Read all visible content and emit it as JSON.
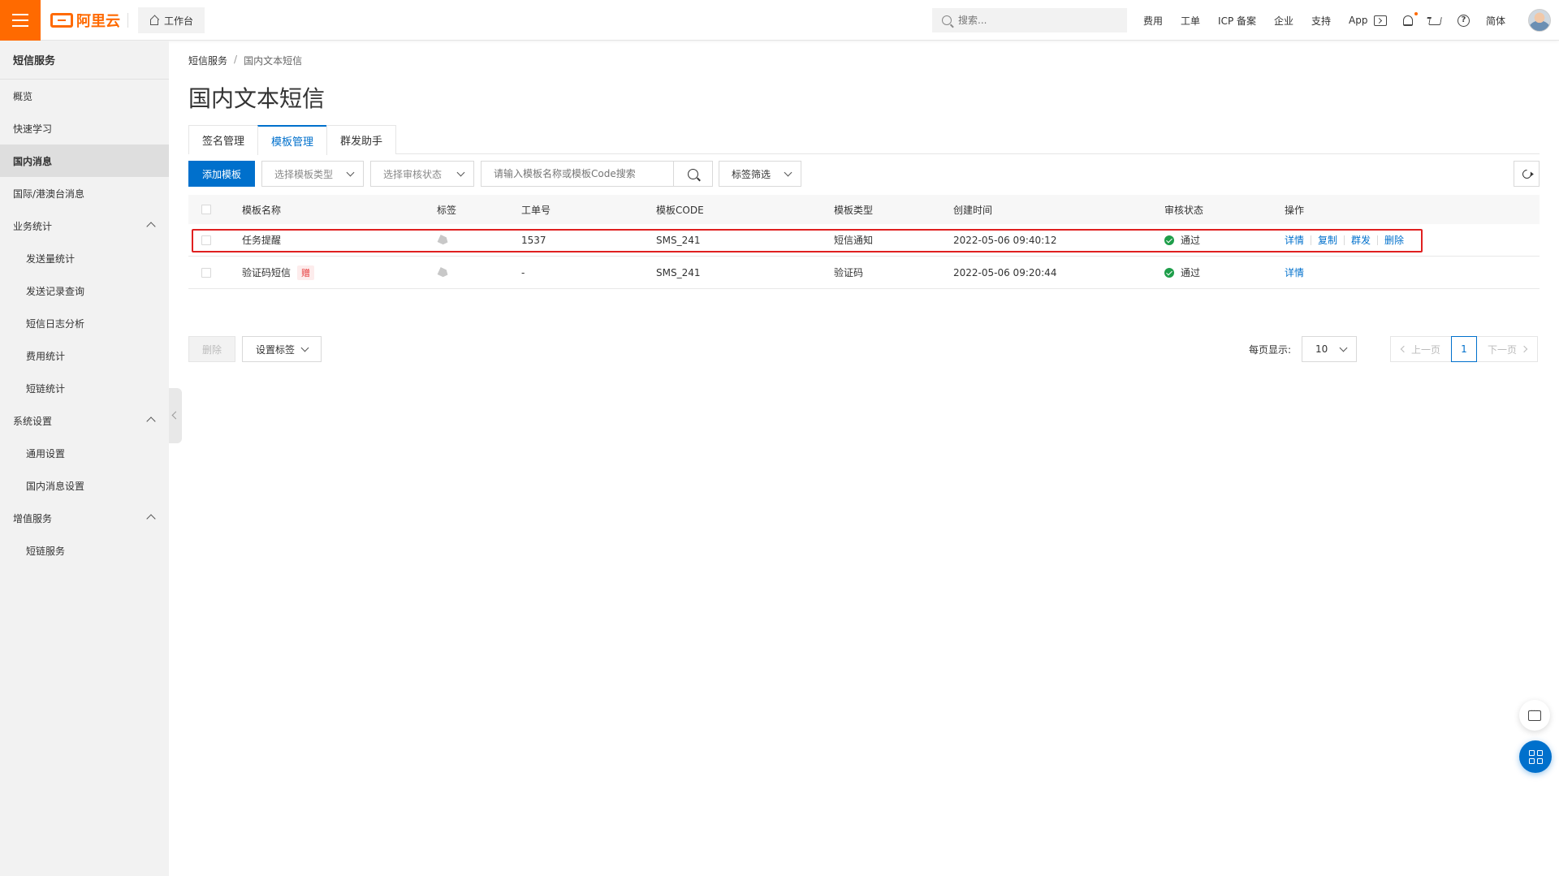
{
  "topbar": {
    "logo_text": "阿里云",
    "workbench_label": "工作台",
    "search_placeholder": "搜索...",
    "links": [
      "费用",
      "工单",
      "ICP 备案",
      "企业",
      "支持",
      "App"
    ],
    "lang": "简体",
    "icons": [
      "menu-icon",
      "home-icon",
      "search-icon",
      "terminal-icon",
      "bell-icon",
      "cart-icon",
      "help-icon"
    ],
    "accent_color": "#ff6a00"
  },
  "sidebar": {
    "title": "短信服务",
    "items": [
      {
        "label": "概览"
      },
      {
        "label": "快速学习"
      },
      {
        "label": "国内消息",
        "active": true
      },
      {
        "label": "国际/港澳台消息"
      },
      {
        "label": "业务统计"
      },
      {
        "label": "发送量统计"
      },
      {
        "label": "发送记录查询"
      },
      {
        "label": "短信日志分析"
      },
      {
        "label": "费用统计"
      },
      {
        "label": "短链统计"
      },
      {
        "label": "系统设置"
      },
      {
        "label": "通用设置"
      },
      {
        "label": "国内消息设置"
      },
      {
        "label": "增值服务"
      },
      {
        "label": "短链服务"
      }
    ]
  },
  "breadcrumb": [
    "短信服务",
    "/",
    "国内文本短信"
  ],
  "page_title": "国内文本短信",
  "tabs": [
    {
      "label": "签名管理"
    },
    {
      "label": "模板管理",
      "active": true
    },
    {
      "label": "群发助手"
    }
  ],
  "toolbar": {
    "add_label": "添加模板",
    "type_select": "选择模板类型",
    "status_select": "选择审核状态",
    "search_placeholder": "请输入模板名称或模板Code搜索",
    "tag_filter": "标签筛选"
  },
  "table": {
    "headers": [
      "模板名称",
      "标签",
      "工单号",
      "模板CODE",
      "模板类型",
      "创建时间",
      "审核状态",
      "操作"
    ],
    "rows": [
      {
        "name": "任务提醒",
        "badge": "",
        "ticket": "1537",
        "code": "SMS_241",
        "type": "短信通知",
        "created": "2022-05-06 09:40:12",
        "status": "通过",
        "ops": [
          "详情",
          "复制",
          "群发",
          "删除"
        ]
      },
      {
        "name": "验证码短信",
        "badge": "赠",
        "ticket": "-",
        "code": "SMS_241",
        "type": "验证码",
        "created": "2022-05-06 09:20:44",
        "status": "通过",
        "ops": [
          "详情"
        ]
      }
    ]
  },
  "footer": {
    "delete_label": "删除",
    "set_tag_label": "设置标签",
    "page_size_label": "每页显示:",
    "page_size": "10",
    "prev": "上一页",
    "page": "1",
    "next": "下一页"
  },
  "primary_color": "#0070cc",
  "success_color": "#1e9e4a",
  "highlight_color": "#e02020"
}
